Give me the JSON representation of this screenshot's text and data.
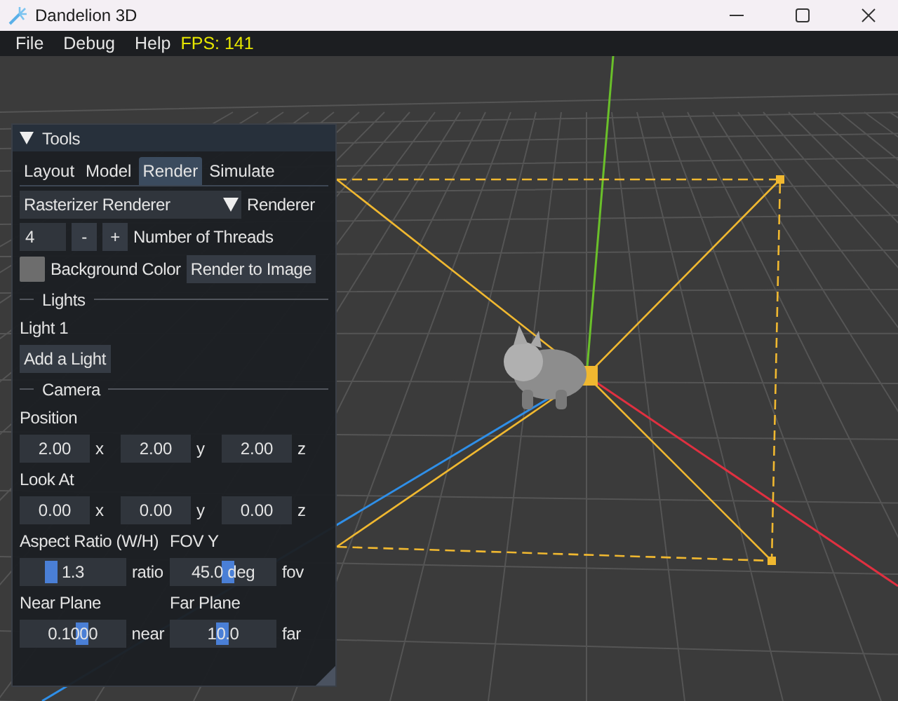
{
  "window": {
    "title": "Dandelion 3D"
  },
  "menu": [
    {
      "label": "File"
    },
    {
      "label": "Debug"
    },
    {
      "label": "Help"
    }
  ],
  "fps": "FPS: 141",
  "tools_panel": {
    "title": "Tools",
    "expanded": true,
    "tabs": [
      {
        "label": "Layout",
        "selected": false
      },
      {
        "label": "Model",
        "selected": false
      },
      {
        "label": "Render",
        "selected": true
      },
      {
        "label": "Simulate",
        "selected": false
      }
    ],
    "renderer": {
      "value": "Rasterizer Renderer",
      "label": "Renderer"
    },
    "threads": {
      "value": "4",
      "decrement": "-",
      "increment": "+",
      "label": "Number of Threads"
    },
    "background": {
      "label": "Background Color",
      "button": "Render to Image"
    },
    "lights": {
      "title": "Lights",
      "items": [
        "Light 1"
      ],
      "add_button": "Add a Light"
    },
    "camera": {
      "title": "Camera",
      "vectors": [
        {
          "label": "Position",
          "fields": [
            {
              "value": "2.00",
              "axis": "x"
            },
            {
              "value": "2.00",
              "axis": "y"
            },
            {
              "value": "2.00",
              "axis": "z"
            }
          ]
        },
        {
          "label": "Look At",
          "fields": [
            {
              "value": "0.00",
              "axis": "x"
            },
            {
              "value": "0.00",
              "axis": "y"
            },
            {
              "value": "0.00",
              "axis": "z"
            }
          ]
        }
      ],
      "sliders": [
        {
          "label": "Aspect Ratio (W/H)",
          "value": "1.3",
          "unit": "ratio",
          "level": 0.3
        },
        {
          "label": "FOV Y",
          "value": "45.0 deg",
          "unit": "fov",
          "level": 0.55
        },
        {
          "label": "Near Plane",
          "value": "0.1000",
          "unit": "near",
          "level": 0.6
        },
        {
          "label": "Far Plane",
          "value": "10.0",
          "unit": "far",
          "level": 0.5
        }
      ]
    }
  }
}
